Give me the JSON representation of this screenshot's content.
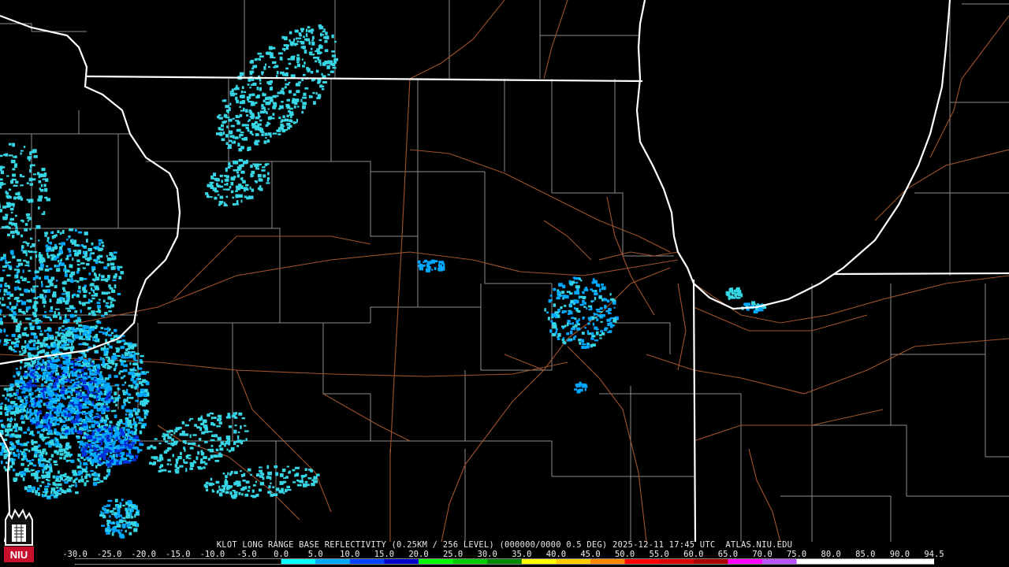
{
  "product_line": "KLOT LONG RANGE BASE REFLECTIVITY (0.25KM / 256 LEVEL) (000000/0000 0.5 DEG) 2025-12-11 17:45 UTC  ATLAS.NIU.EDU",
  "logo_text": "NIU",
  "scale": {
    "ticks": [
      "-30.0",
      "-25.0",
      "-20.0",
      "-15.0",
      "-10.0",
      "-5.0",
      "0.0",
      "5.0",
      "10.0",
      "15.0",
      "20.0",
      "25.0",
      "30.0",
      "35.0",
      "40.0",
      "45.0",
      "50.0",
      "55.0",
      "60.0",
      "65.0",
      "70.0",
      "75.0",
      "80.0",
      "85.0",
      "90.0",
      "94.5"
    ],
    "colors": [
      "#000000",
      "#000000",
      "#000000",
      "#000000",
      "#000000",
      "#000000",
      "#00ffff",
      "#00aaff",
      "#0044ff",
      "#0000cc",
      "#00ff00",
      "#00cc00",
      "#008800",
      "#ffff00",
      "#ffcc00",
      "#ff8800",
      "#ff0000",
      "#dd0000",
      "#aa0000",
      "#ff00ff",
      "#bb55ff",
      "#ffffff",
      "#ffffff",
      "#ffffff",
      "#ffffff"
    ]
  },
  "colors": {
    "state_lines": "#ffffff",
    "county_lines": "#9a9a9a",
    "roads": "#a0522d",
    "echo_light": "#36d6e6",
    "echo_mid": "#00a8ff",
    "echo_heavy": "#0030d8",
    "background": "#000000"
  }
}
